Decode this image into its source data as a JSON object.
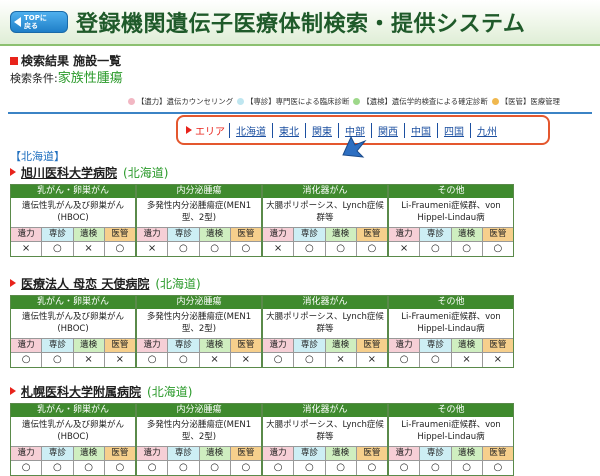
{
  "header": {
    "top_button": "TOPに\n戻る",
    "title": "登録機関遺伝子医療体制検索・提供システム"
  },
  "results": {
    "heading": "検索結果 施設一覧",
    "condition_label": "検索条件:",
    "condition_value": "家族性腫瘍"
  },
  "legend": [
    {
      "color": "#f2b7c3",
      "text": "【遺力】遺伝カウンセリング"
    },
    {
      "color": "#bfe6f0",
      "text": "【専診】専門医による臨床診断"
    },
    {
      "color": "#9ed88a",
      "text": "【遺検】遺伝学的検査による確定診断"
    },
    {
      "color": "#f0b84f",
      "text": "【医管】医療管理"
    }
  ],
  "area_nav": {
    "label": "エリア",
    "links": [
      "北海道",
      "東北",
      "関東",
      "中部",
      "関西",
      "中国",
      "四国",
      "九州"
    ]
  },
  "region_label": "【北海道】",
  "card_headers": [
    "乳がん・卵巣がん",
    "内分泌腫瘍",
    "消化器がん",
    "その他"
  ],
  "card_descs": [
    "遺伝性乳がん及び卵巣がん(HBOC)",
    "多発性内分泌腫瘍症(MEN1型、2型)",
    "大腸ポリポーシス、Lynch症候群等",
    "Li-Fraumeni症候群、von Hippel-Lindau病"
  ],
  "col_labels": [
    "遺力",
    "専診",
    "遺検",
    "医管"
  ],
  "facilities": [
    {
      "name": "旭川医科大学病院",
      "pref": "(北海道)",
      "marks": [
        [
          "×",
          "○",
          "×",
          "○"
        ],
        [
          "×",
          "○",
          "○",
          "○"
        ],
        [
          "×",
          "○",
          "○",
          "○"
        ],
        [
          "×",
          "○",
          "○",
          "○"
        ]
      ]
    },
    {
      "name": "医療法人 母恋 天使病院",
      "pref": "(北海道)",
      "marks": [
        [
          "○",
          "○",
          "×",
          "×"
        ],
        [
          "○",
          "○",
          "×",
          "×"
        ],
        [
          "○",
          "○",
          "×",
          "×"
        ],
        [
          "○",
          "○",
          "×",
          "×"
        ]
      ]
    },
    {
      "name": "札幌医科大学附属病院",
      "pref": "(北海道)",
      "marks": [
        [
          "○",
          "○",
          "○",
          "○"
        ],
        [
          "○",
          "○",
          "○",
          "○"
        ],
        [
          "○",
          "○",
          "○",
          "○"
        ],
        [
          "○",
          "○",
          "○",
          "○"
        ]
      ]
    }
  ]
}
